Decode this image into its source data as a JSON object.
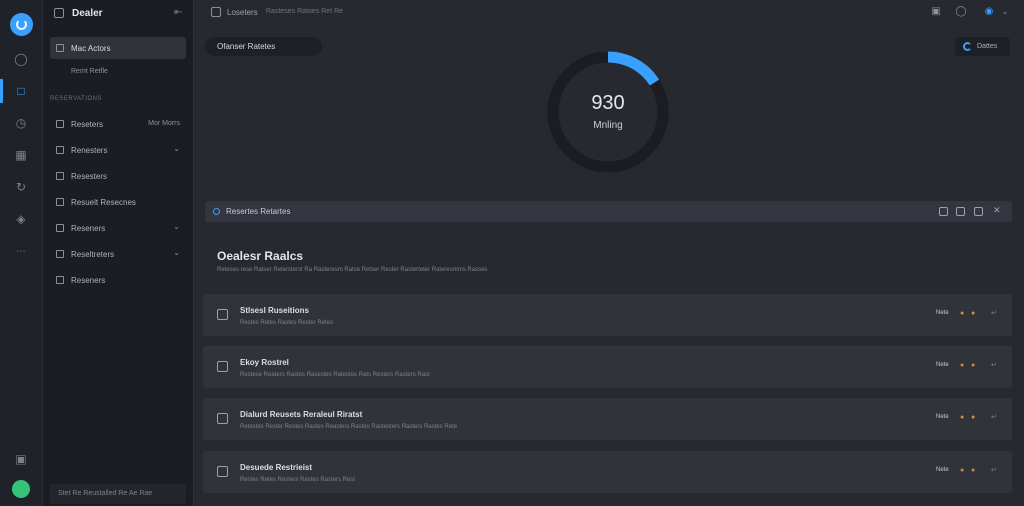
{
  "app": {
    "accent": "#3aa0ff",
    "title": "Dealer"
  },
  "rail": {
    "icons": [
      "logo-icon",
      "circle-icon",
      "calendar-icon",
      "clock-icon",
      "grid-icon",
      "refresh-icon",
      "shield-icon",
      "more-icon",
      "settings-icon",
      "avatar"
    ]
  },
  "sidebar": {
    "collapse_icon": "collapse-icon",
    "items": [
      {
        "label": "Mac Actors",
        "active": true
      },
      {
        "label": "Reseters",
        "meta": "Mor Morrs"
      },
      {
        "label": "Renesters",
        "chevron": true
      },
      {
        "label": "Resesters"
      },
      {
        "label": "Resuelt Resecnes"
      },
      {
        "label": "Reseners",
        "chevron": true
      },
      {
        "label": "Reseltreters",
        "chevron": true
      },
      {
        "label": "Reseners"
      }
    ],
    "sub_label": "Remt Retfle",
    "section_label": "RESERVATIONS",
    "footer_text": "Stet Re Reustalled Re Ae Rae"
  },
  "topbar": {
    "crumb": "Loseters",
    "crumb_secondary": "Rasteses Ratoes   Ret   Re"
  },
  "main": {
    "pill_label": "Ofanser Ratetes",
    "action_label": "Dattes",
    "gauge": {
      "value": "930",
      "label": "Mnling",
      "fraction": 0.16,
      "color": "#3aa0ff"
    },
    "filter_label": "Resertes Retartes",
    "section_title": "Oealesr Raalcs",
    "section_subtitle": "Reteses rese Ratser Retersterst Ra Rasteresm Ratse Retser Rester Rasterteter Rateresmms Rasses",
    "cards": [
      {
        "title": "Stlsesl Ruseitions",
        "desc": "Restes Retes Rastes Rester Retes",
        "meta": "Nete"
      },
      {
        "title": "Ekoy Rostrel",
        "desc": "Restese Reaters Rastes Rasestes Ratestes Rats Resters Rasters Rast",
        "meta": "Nete"
      },
      {
        "title": "Dialurd Reusets Reraleul Riratst",
        "desc": "Retestes Rester Restes Rastes Reasters Rastes Rastesters Rasters Rastes Rete",
        "meta": "Nete"
      },
      {
        "title": "Desuede Restrieist",
        "desc": "Restes Retes Resters Rastes Rasters Rest",
        "meta": "Nete"
      }
    ]
  }
}
